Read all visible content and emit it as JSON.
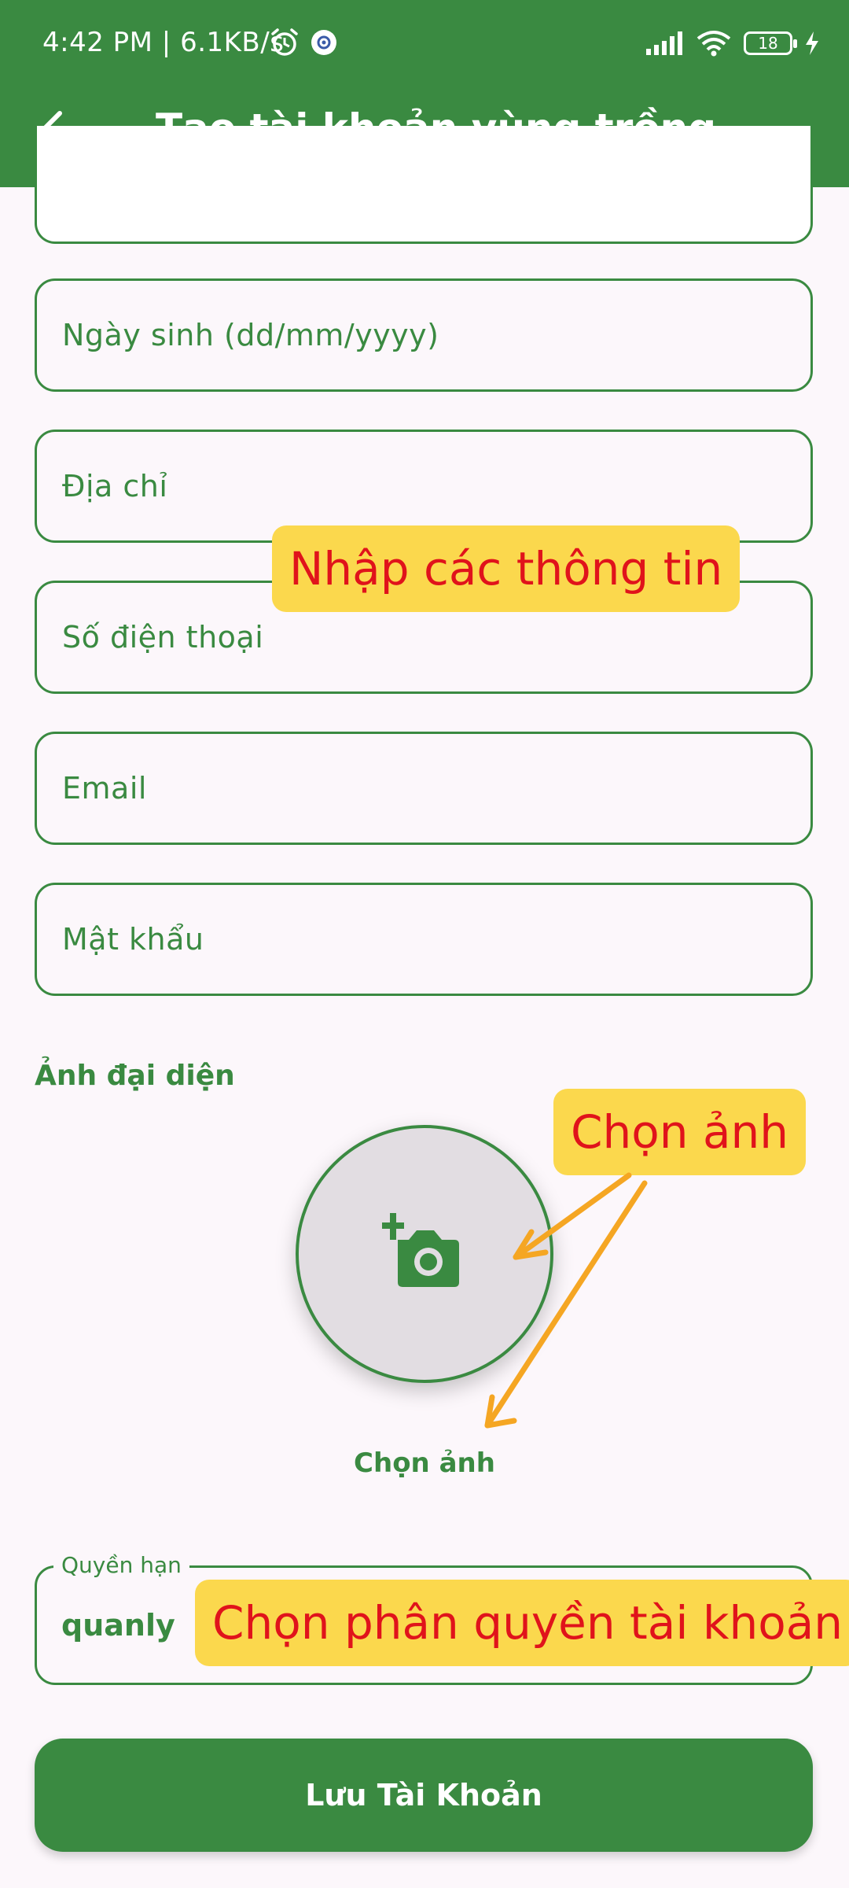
{
  "status_bar": {
    "time_speed": "4:42 PM | 6.1KB/s",
    "battery": "18"
  },
  "app_bar": {
    "title": "Tạo tài khoản vùng trồng"
  },
  "form": {
    "birthdate_placeholder": "Ngày sinh (dd/mm/yyyy)",
    "address_placeholder": "Địa chỉ",
    "phone_placeholder": "Số điện thoại",
    "email_placeholder": "Email",
    "password_placeholder": "Mật khẩu",
    "avatar_label": "Ảnh đại diện",
    "choose_image_label": "Chọn ảnh",
    "role_legend": "Quyền hạn",
    "role_value": "quanly",
    "save_label": "Lưu Tài Khoản"
  },
  "annotations": {
    "enter_info": "Nhập các thông tin",
    "choose_image": "Chọn ảnh",
    "choose_role": "Chọn phân quyền tài khoản"
  },
  "colors": {
    "primary": "#3a8a41",
    "background": "#fcf7fb",
    "callout_bg": "#fbd84d",
    "callout_text": "#e0131b",
    "arrow": "#f5a623"
  },
  "icons": [
    "back-arrow-icon",
    "alarm-icon",
    "settings-icon",
    "signal-icon",
    "wifi-icon",
    "battery-icon",
    "charging-icon",
    "add-photo-icon"
  ]
}
